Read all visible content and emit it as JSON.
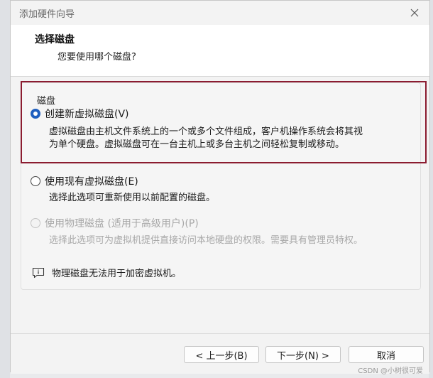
{
  "window": {
    "title": "添加硬件向导"
  },
  "header": {
    "title": "选择磁盘",
    "subtitle": "您要使用哪个磁盘?"
  },
  "group": {
    "legend": "磁盘"
  },
  "options": [
    {
      "label": "创建新虚拟磁盘(V)",
      "checked": true,
      "enabled": true,
      "description_lines": [
        "虚拟磁盘由主机文件系统上的一个或多个文件组成，客户机操作系统会将其视",
        "为单个硬盘。虚拟磁盘可在一台主机上或多台主机之间轻松复制或移动。"
      ]
    },
    {
      "label": "使用现有虚拟磁盘(E)",
      "checked": false,
      "enabled": true,
      "description_lines": [
        "选择此选项可重新使用以前配置的磁盘。"
      ]
    },
    {
      "label": "使用物理磁盘 (适用于高级用户)(P)",
      "checked": false,
      "enabled": false,
      "description_lines": [
        "选择此选项可为虚拟机提供直接访问本地硬盘的权限。需要具有管理员特权。"
      ]
    }
  ],
  "note": {
    "text": "物理磁盘无法用于加密虚拟机。",
    "icon": "info-comment-icon"
  },
  "buttons": {
    "back": "< 上一步(B)",
    "next": "下一步(N) >",
    "cancel": "取消"
  },
  "watermark": "CSDN @小树很可爱",
  "colors": {
    "highlight": "#8b1c30",
    "radio_checked": "#1f5fbf"
  }
}
